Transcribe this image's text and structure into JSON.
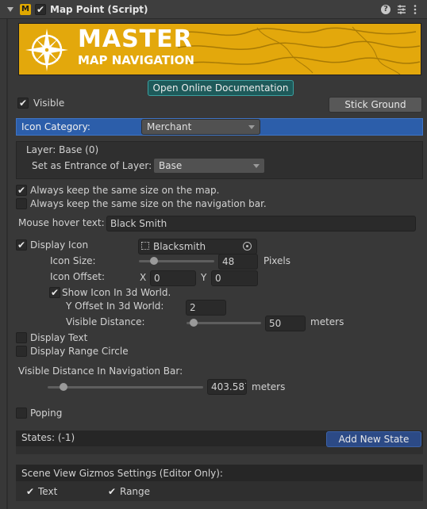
{
  "header": {
    "title": "Map Point (Script)",
    "enabled_check": "✔",
    "icons": [
      "help-icon",
      "presets-icon",
      "more-icon"
    ]
  },
  "banner": {
    "line1": "MASTER",
    "line2": "MAP NAVIGATION"
  },
  "docs_button": "Open Online Documentation",
  "visible": {
    "label": "Visible",
    "check": "✔"
  },
  "stick_ground_button": "Stick Ground",
  "icon_category": {
    "label": "Icon Category:",
    "value": "Merchant"
  },
  "layer": {
    "label": "Layer: Base (0)",
    "entrance_label": "Set as Entrance of Layer:",
    "entrance_value": "Base"
  },
  "options": {
    "keep_size_map": {
      "label": "Always keep the same size on the map.",
      "check": "✔"
    },
    "keep_size_bar": {
      "label": "Always keep the same size on the navigation bar.",
      "check": ""
    }
  },
  "mouse_hover": {
    "label": "Mouse hover text:",
    "value": "Black Smith"
  },
  "display_icon": {
    "label": "Display Icon",
    "check": "✔",
    "icon_value": "Blacksmith",
    "size_label": "Icon Size:",
    "size_value": "48",
    "size_unit": "Pixels",
    "size_fraction": 0.2,
    "offset_label": "Icon Offset:",
    "x_label": "X",
    "x_value": "0",
    "y_label": "Y",
    "y_value": "0",
    "show3d_label": "Show Icon In 3d World.",
    "show3d_check": "✔",
    "yoffset_label": "Y Offset In 3d World:",
    "yoffset_value": "2",
    "visdist_label": "Visible Distance:",
    "visdist_value": "50",
    "visdist_unit": "meters",
    "visdist_fraction": 0.1
  },
  "display_text": {
    "label": "Display Text",
    "check": ""
  },
  "display_range": {
    "label": "Display Range Circle",
    "check": ""
  },
  "nav_bar_distance": {
    "label": "Visible Distance In Navigation Bar:",
    "value": "403.587",
    "unit": "meters",
    "fraction": 0.1
  },
  "poping": {
    "label": "Poping",
    "check": ""
  },
  "states": {
    "label": "States: (-1)",
    "button": "Add New State"
  },
  "gizmos": {
    "label": "Scene View Gizmos Settings (Editor Only):",
    "text_label": "Text",
    "text_check": "✔",
    "range_label": "Range",
    "range_check": "✔"
  },
  "colors": {
    "accent_blue": "#2c5eaa",
    "docs_teal": "#1e5a5a",
    "banner_gold": "#e3a80c"
  }
}
